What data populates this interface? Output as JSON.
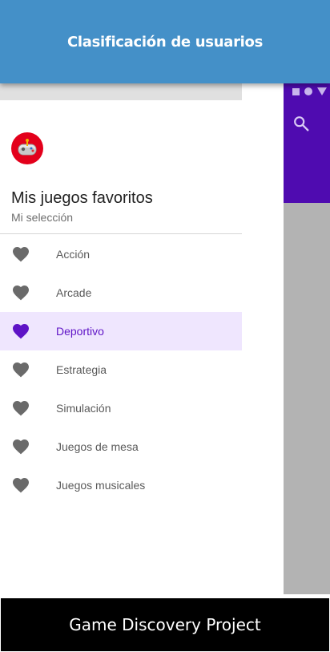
{
  "banner": {
    "title": "Clasificación de usuarios"
  },
  "app": {
    "toolbar_color": "#4f0bb0",
    "search_icon": "search-icon"
  },
  "drawer": {
    "title": "Mis juegos favoritos",
    "subtitle": "Mi selección",
    "avatar_icon": "game-controller-icon",
    "items": [
      {
        "label": "Acción",
        "icon": "heart-icon",
        "active": false
      },
      {
        "label": "Arcade",
        "icon": "heart-icon",
        "active": false
      },
      {
        "label": "Deportivo",
        "icon": "heart-icon",
        "active": true
      },
      {
        "label": "Estrategia",
        "icon": "heart-icon",
        "active": false
      },
      {
        "label": "Simulación",
        "icon": "heart-icon",
        "active": false
      },
      {
        "label": "Juegos de mesa",
        "icon": "heart-icon",
        "active": false
      },
      {
        "label": "Juegos musicales",
        "icon": "heart-icon",
        "active": false
      }
    ]
  },
  "footer": {
    "text": "Game Discovery Project"
  },
  "colors": {
    "accent": "#5e13c6",
    "banner": "#4490c8",
    "heart": "#6a6a6a",
    "active_bg": "#efe6fe"
  }
}
